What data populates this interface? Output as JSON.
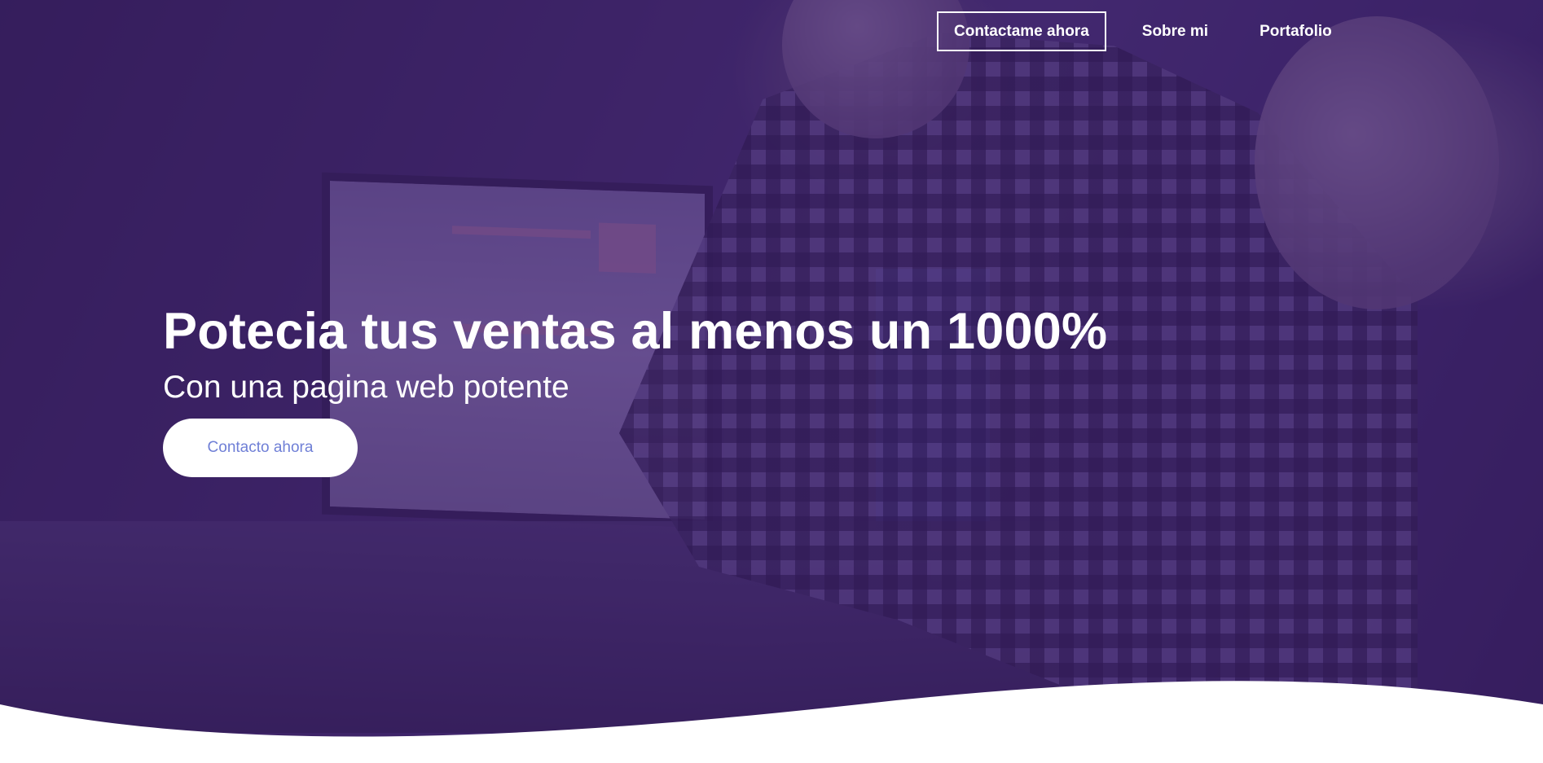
{
  "nav": {
    "cta_label": "Contactame ahora",
    "items": [
      {
        "label": "Sobre mi"
      },
      {
        "label": "Portafolio"
      }
    ]
  },
  "hero": {
    "title": "Potecia tus ventas al menos un 1000%",
    "subtitle": "Con una pagina web potente",
    "button_label": "Contacto ahora"
  },
  "colors": {
    "overlay": "#3c1e6e",
    "button_text": "#6f7fd6",
    "wave": "#ffffff"
  }
}
